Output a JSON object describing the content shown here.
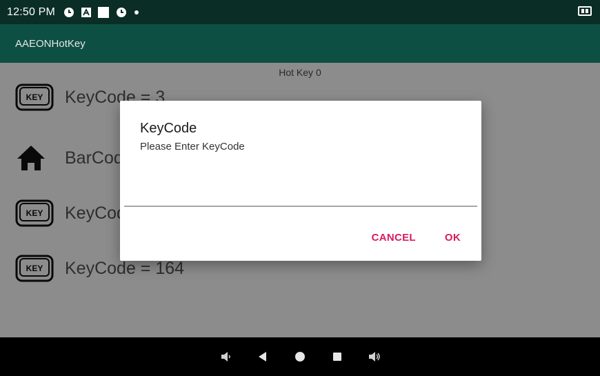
{
  "status_bar": {
    "time": "12:50 PM"
  },
  "app_bar": {
    "title": "AAEONHotKey"
  },
  "content": {
    "header": "Hot Key 0",
    "rows": [
      {
        "icon": "key-icon",
        "label": "KeyCode = 3"
      },
      {
        "icon": "home-icon",
        "label": "BarCode"
      },
      {
        "icon": "key-icon",
        "label": "KeyCode"
      },
      {
        "icon": "key-icon",
        "label": "KeyCode = 164"
      }
    ]
  },
  "dialog": {
    "title": "KeyCode",
    "message": "Please Enter KeyCode",
    "input_value": "",
    "cancel_label": "CANCEL",
    "ok_label": "OK",
    "accent_color": "#d81b60"
  },
  "key_icon_text": "KEY",
  "colors": {
    "status_bar": "#0a2d25",
    "app_bar": "#0d4f43",
    "nav_bar": "#000000"
  }
}
